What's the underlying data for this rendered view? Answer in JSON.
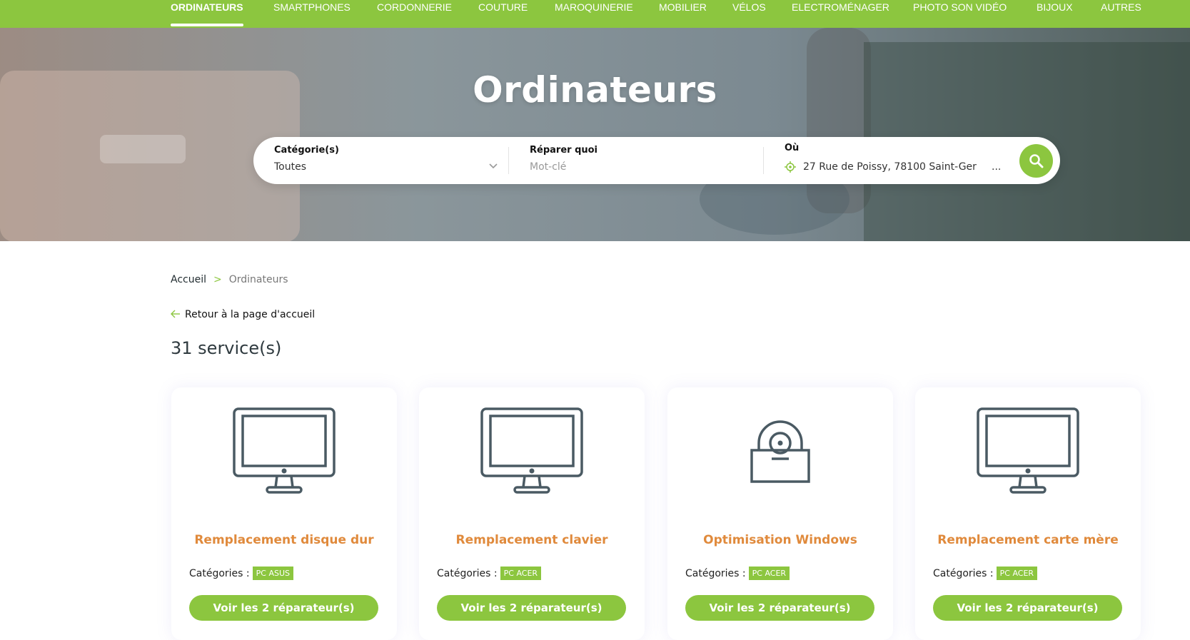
{
  "nav": {
    "items": [
      {
        "label": "ORDINATEURS",
        "active": true
      },
      {
        "label": "SMARTPHONES"
      },
      {
        "label": "CORDONNERIE"
      },
      {
        "label": "COUTURE"
      },
      {
        "label": "MAROQUINERIE"
      },
      {
        "label": "MOBILIER"
      },
      {
        "label": "VÉLOS"
      },
      {
        "label": "ELECTROMÉNAGER"
      },
      {
        "label": "PHOTO SON VIDÉO"
      },
      {
        "label": "BIJOUX"
      },
      {
        "label": "AUTRES"
      }
    ]
  },
  "hero": {
    "title": "Ordinateurs"
  },
  "search": {
    "category_label": "Catégorie(s)",
    "category_value": "Toutes",
    "what_label": "Réparer quoi",
    "what_placeholder": "Mot-clé",
    "where_label": "Où",
    "where_value": "27 Rue de Poissy, 78100 Saint-Ger",
    "where_ellipsis": "..."
  },
  "breadcrumb": {
    "home": "Accueil",
    "separator": ">",
    "current": "Ordinateurs"
  },
  "back_link": "Retour à la page d'accueil",
  "count": "31 service(s)",
  "categories_label": "Catégories :",
  "cards": [
    {
      "title": "Remplacement disque dur",
      "icon": "monitor-icon",
      "badge": "PC ASUS",
      "button": "Voir les 2 réparateur(s)"
    },
    {
      "title": "Remplacement clavier",
      "icon": "monitor-icon",
      "badge": "PC ACER",
      "button": "Voir les 2 réparateur(s)"
    },
    {
      "title": "Optimisation Windows",
      "icon": "lock-disc-icon",
      "badge": "PC ACER",
      "button": "Voir les 2 réparateur(s)"
    },
    {
      "title": "Remplacement carte mère",
      "icon": "monitor-icon",
      "badge": "PC ACER",
      "button": "Voir les 2 réparateur(s)"
    }
  ],
  "colors": {
    "brand": "#8cc63f",
    "title": "#e08a3c",
    "icon": "#4a5a63"
  }
}
